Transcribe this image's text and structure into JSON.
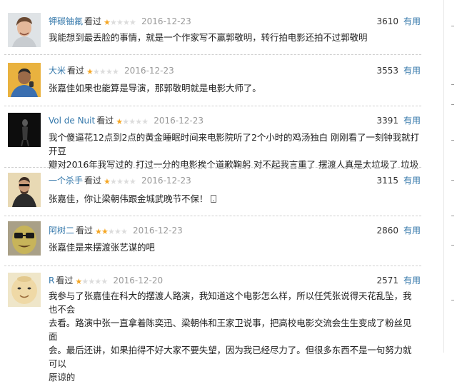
{
  "watched_label": "看过",
  "useful_label": "有用",
  "colors": {
    "link": "#3377aa",
    "star": "#f5a623",
    "star_off": "#dcdcdc",
    "date": "#999999"
  },
  "reviews": [
    {
      "user": "钾碳铀氟",
      "stars": 1,
      "date": "2016-12-23",
      "votes": "3610",
      "lines": [
        "我能想到最丢脸的事情，就是一个作家写不赢郭敬明，转行拍电影还拍不过郭敬明"
      ]
    },
    {
      "user": "大米",
      "stars": 1,
      "date": "2016-12-23",
      "votes": "3553",
      "lines": [
        "张嘉佳如果也能算是导演，那郭敬明就是电影大师了。"
      ]
    },
    {
      "user": "Vol de Nuit",
      "stars": 1,
      "date": "2016-12-23",
      "votes": "3391",
      "lines": [
        "我个傻逼花12点到2点的黄金睡眠时间来电影院听了2个小时的鸡汤独白 刚刚看了一刻钟我就打开豆",
        "瓣对2016年我写过的 打过一分的电影挨个道歉鞠躬 对不起我言重了 摆渡人真是太垃圾了 垃圾"
      ]
    },
    {
      "user": "一个杀手",
      "stars": 1,
      "date": "2016-12-23",
      "votes": "3115",
      "lines": [
        "张嘉佳，你让梁朝伟跟金城武晚节不保！"
      ]
    },
    {
      "user": "阿树二",
      "stars": 2,
      "date": "2016-12-23",
      "votes": "2860",
      "lines": [
        "张嘉佳是来摆渡张艺谋的吧"
      ]
    },
    {
      "user": "R",
      "stars": 1,
      "date": "2016-12-20",
      "votes": "2571",
      "lines": [
        "我参与了张嘉佳在科大的摆渡人路演，我知道这个电影怎么样，所以任凭张说得天花乱坠，我也不会",
        "去看。路演中张一直拿着陈奕迅、梁朝伟和王家卫说事，把高校电影交流会生生变成了粉丝见面",
        "会。最后还讲，如果拍得不好大家不要失望，因为我已经尽力了。但很多东西不是一句努力就可以",
        "原谅的"
      ]
    }
  ]
}
